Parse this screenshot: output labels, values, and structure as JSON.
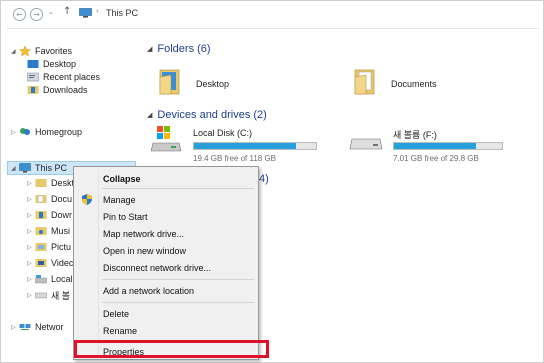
{
  "address": {
    "back_glyph": "←",
    "forward_glyph": "→",
    "dropdown_glyph": "⌄",
    "up_glyph": "↑",
    "separator": "›",
    "location": "This PC"
  },
  "nav": {
    "expand_glyph": "◢",
    "collapsed_glyph": "▷",
    "favorites": "Favorites",
    "desktop": "Desktop",
    "recent": "Recent places",
    "downloads": "Downloads",
    "homegroup": "Homegroup",
    "this_pc": "This PC",
    "children": [
      "Deskt",
      "Docu",
      "Dowr",
      "Musi",
      "Pictu",
      "Videc",
      "Local",
      "새 볼"
    ],
    "network": "Networ"
  },
  "content": {
    "section_glyph": "◢",
    "folders_title": "Folders (6)",
    "folders": [
      "Desktop",
      "Documents"
    ],
    "devices_title": "Devices and drives (2)",
    "drives": [
      {
        "name": "Local Disk (C:)",
        "free": "19.4 GB free of 118 GB",
        "used_fraction": 0.84
      },
      {
        "name": "새 볼륨 (F:)",
        "free": "7.01 GB free of 29.8 GB",
        "used_fraction": 0.76
      }
    ],
    "hidden_fragment": "4)"
  },
  "context_menu": {
    "collapse": "Collapse",
    "manage": "Manage",
    "pin_to_start": "Pin to Start",
    "map_network_drive": "Map network drive...",
    "open_new_window": "Open in new window",
    "disconnect_network_drive": "Disconnect network drive...",
    "add_network_location": "Add a network location",
    "delete": "Delete",
    "rename": "Rename",
    "properties": "Properties"
  },
  "colors": {
    "accent": "#26a0da",
    "highlight_box": "#e0112a",
    "section_title": "#1e3f8a"
  },
  "icons": [
    "back-arrow-icon",
    "forward-arrow-icon",
    "up-arrow-icon",
    "star-icon",
    "folder-icon",
    "drive-icon",
    "computer-icon",
    "homegroup-icon",
    "network-icon",
    "shield-icon"
  ]
}
